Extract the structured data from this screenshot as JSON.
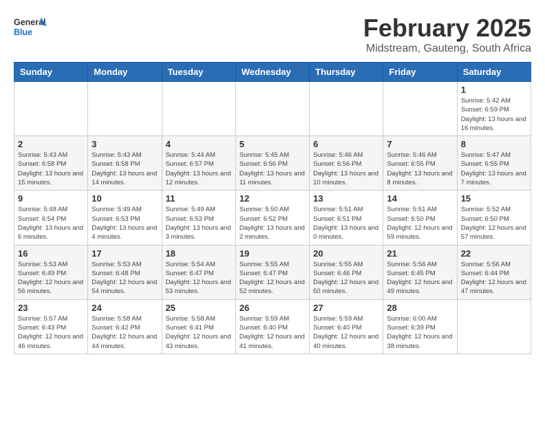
{
  "header": {
    "logo_general": "General",
    "logo_blue": "Blue",
    "month_title": "February 2025",
    "location": "Midstream, Gauteng, South Africa"
  },
  "weekdays": [
    "Sunday",
    "Monday",
    "Tuesday",
    "Wednesday",
    "Thursday",
    "Friday",
    "Saturday"
  ],
  "weeks": [
    [
      {
        "day": "",
        "info": ""
      },
      {
        "day": "",
        "info": ""
      },
      {
        "day": "",
        "info": ""
      },
      {
        "day": "",
        "info": ""
      },
      {
        "day": "",
        "info": ""
      },
      {
        "day": "",
        "info": ""
      },
      {
        "day": "1",
        "info": "Sunrise: 5:42 AM\nSunset: 6:59 PM\nDaylight: 13 hours and 16 minutes."
      }
    ],
    [
      {
        "day": "2",
        "info": "Sunrise: 5:43 AM\nSunset: 6:58 PM\nDaylight: 13 hours and 15 minutes."
      },
      {
        "day": "3",
        "info": "Sunrise: 5:43 AM\nSunset: 6:58 PM\nDaylight: 13 hours and 14 minutes."
      },
      {
        "day": "4",
        "info": "Sunrise: 5:44 AM\nSunset: 6:57 PM\nDaylight: 13 hours and 12 minutes."
      },
      {
        "day": "5",
        "info": "Sunrise: 5:45 AM\nSunset: 6:56 PM\nDaylight: 13 hours and 11 minutes."
      },
      {
        "day": "6",
        "info": "Sunrise: 5:46 AM\nSunset: 6:56 PM\nDaylight: 13 hours and 10 minutes."
      },
      {
        "day": "7",
        "info": "Sunrise: 5:46 AM\nSunset: 6:55 PM\nDaylight: 13 hours and 8 minutes."
      },
      {
        "day": "8",
        "info": "Sunrise: 5:47 AM\nSunset: 6:55 PM\nDaylight: 13 hours and 7 minutes."
      }
    ],
    [
      {
        "day": "9",
        "info": "Sunrise: 5:48 AM\nSunset: 6:54 PM\nDaylight: 13 hours and 6 minutes."
      },
      {
        "day": "10",
        "info": "Sunrise: 5:49 AM\nSunset: 6:53 PM\nDaylight: 13 hours and 4 minutes."
      },
      {
        "day": "11",
        "info": "Sunrise: 5:49 AM\nSunset: 6:53 PM\nDaylight: 13 hours and 3 minutes."
      },
      {
        "day": "12",
        "info": "Sunrise: 5:50 AM\nSunset: 6:52 PM\nDaylight: 13 hours and 2 minutes."
      },
      {
        "day": "13",
        "info": "Sunrise: 5:51 AM\nSunset: 6:51 PM\nDaylight: 13 hours and 0 minutes."
      },
      {
        "day": "14",
        "info": "Sunrise: 5:51 AM\nSunset: 6:50 PM\nDaylight: 12 hours and 59 minutes."
      },
      {
        "day": "15",
        "info": "Sunrise: 5:52 AM\nSunset: 6:50 PM\nDaylight: 12 hours and 57 minutes."
      }
    ],
    [
      {
        "day": "16",
        "info": "Sunrise: 5:53 AM\nSunset: 6:49 PM\nDaylight: 12 hours and 56 minutes."
      },
      {
        "day": "17",
        "info": "Sunrise: 5:53 AM\nSunset: 6:48 PM\nDaylight: 12 hours and 54 minutes."
      },
      {
        "day": "18",
        "info": "Sunrise: 5:54 AM\nSunset: 6:47 PM\nDaylight: 12 hours and 53 minutes."
      },
      {
        "day": "19",
        "info": "Sunrise: 5:55 AM\nSunset: 6:47 PM\nDaylight: 12 hours and 52 minutes."
      },
      {
        "day": "20",
        "info": "Sunrise: 5:55 AM\nSunset: 6:46 PM\nDaylight: 12 hours and 50 minutes."
      },
      {
        "day": "21",
        "info": "Sunrise: 5:56 AM\nSunset: 6:45 PM\nDaylight: 12 hours and 49 minutes."
      },
      {
        "day": "22",
        "info": "Sunrise: 5:56 AM\nSunset: 6:44 PM\nDaylight: 12 hours and 47 minutes."
      }
    ],
    [
      {
        "day": "23",
        "info": "Sunrise: 5:57 AM\nSunset: 6:43 PM\nDaylight: 12 hours and 46 minutes."
      },
      {
        "day": "24",
        "info": "Sunrise: 5:58 AM\nSunset: 6:42 PM\nDaylight: 12 hours and 44 minutes."
      },
      {
        "day": "25",
        "info": "Sunrise: 5:58 AM\nSunset: 6:41 PM\nDaylight: 12 hours and 43 minutes."
      },
      {
        "day": "26",
        "info": "Sunrise: 5:59 AM\nSunset: 6:40 PM\nDaylight: 12 hours and 41 minutes."
      },
      {
        "day": "27",
        "info": "Sunrise: 5:59 AM\nSunset: 6:40 PM\nDaylight: 12 hours and 40 minutes."
      },
      {
        "day": "28",
        "info": "Sunrise: 6:00 AM\nSunset: 6:39 PM\nDaylight: 12 hours and 38 minutes."
      },
      {
        "day": "",
        "info": ""
      }
    ]
  ]
}
